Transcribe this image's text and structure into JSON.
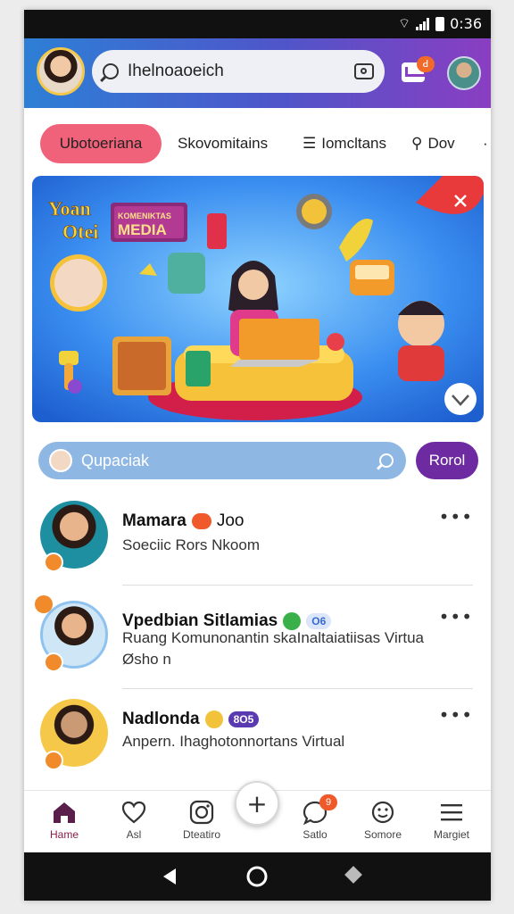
{
  "statusbar": {
    "time": "0:36",
    "icons": [
      "wifi-icon",
      "signal-icon",
      "battery-icon"
    ]
  },
  "header": {
    "search_text": "Ihelnoaoeich",
    "inbox_badge": "ꓒ",
    "colors": {
      "gradient_start": "#2d7fd6",
      "gradient_end": "#8a3ec2"
    }
  },
  "tabs": [
    {
      "label": "Ubotoeriana",
      "icon": ""
    },
    {
      "label": "Skovomitains",
      "icon": ""
    },
    {
      "label": "Iomcltans",
      "icon": "list-icon"
    },
    {
      "label": "Dov",
      "icon": "search-icon"
    }
  ],
  "tabs_more": "·",
  "banner": {
    "title_line1": "Yoan",
    "title_line2": "Otei",
    "sign_top": "KOMENIKTAS",
    "sign_main": "MEDIA"
  },
  "sub_search": {
    "text": "Qupaciak"
  },
  "post_button_label": "Rorol",
  "feed": [
    {
      "name": "Mamara",
      "name_suffix": "Joo",
      "badge": "",
      "subtitle": "Soeciic Rors Nkoom",
      "extra": ""
    },
    {
      "name": "Vpedbian Sitlamias",
      "name_suffix": "",
      "badge": "O6",
      "subtitle": "Ruang Komunonantin skaInaltaiatiisas Virtua",
      "extra": "Øsho n"
    },
    {
      "name": "Nadlonda",
      "name_suffix": "",
      "badge": "8O5",
      "subtitle": "Anpern. Ihaghotonnortans Virtual",
      "extra": ""
    }
  ],
  "more_label": "•••",
  "bottom_nav": [
    {
      "label": "Hame",
      "icon": "home-icon"
    },
    {
      "label": "Asl",
      "icon": "heart-icon"
    },
    {
      "label": "Dteatiro",
      "icon": "instagram-icon"
    },
    {
      "label": "Satlo",
      "icon": "chat-icon",
      "badge": "9"
    },
    {
      "label": "Somore",
      "icon": "smile-icon"
    },
    {
      "label": "Margiet",
      "icon": "menu-icon"
    }
  ],
  "fab_label": "+",
  "colors": {
    "accent_pink": "#f0627a",
    "accent_purple": "#6e2aa0",
    "home_active": "#8a1f4a"
  }
}
